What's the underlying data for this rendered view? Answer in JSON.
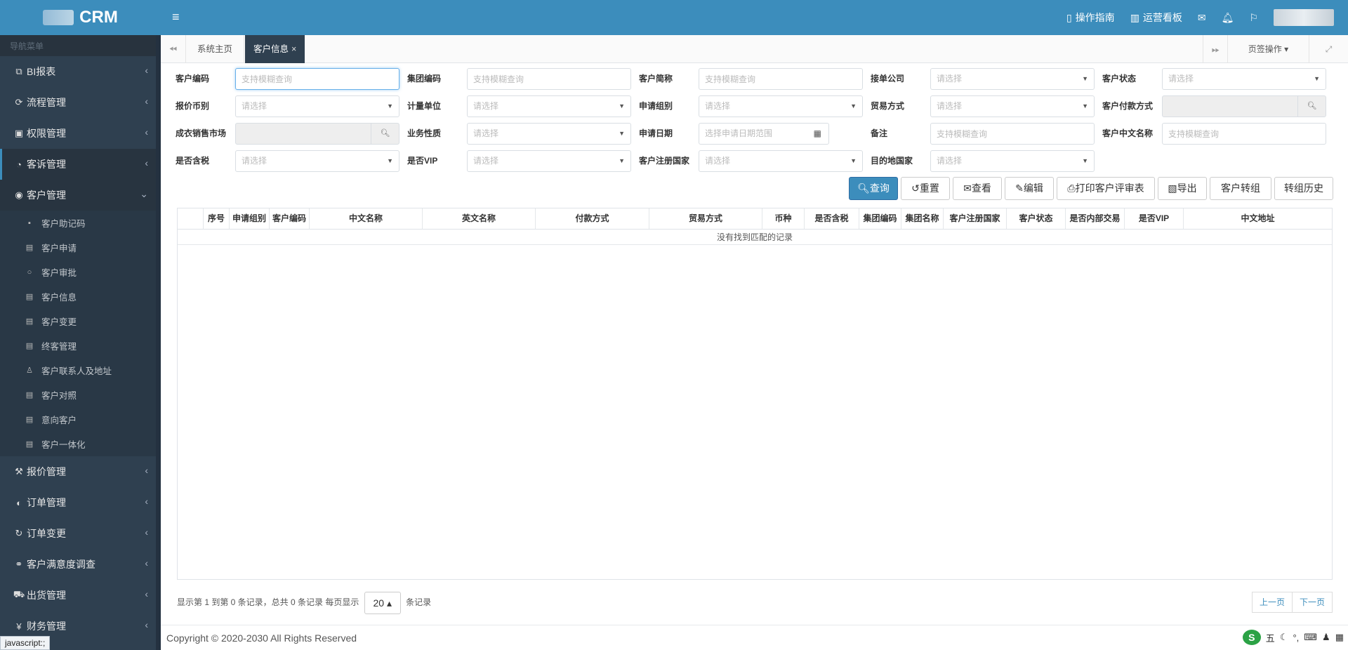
{
  "app": {
    "logo_text": "CRM"
  },
  "sidebar": {
    "nav_title": "导航菜单",
    "menu": [
      {
        "label": "BI报表",
        "icon": "clone-icon"
      },
      {
        "label": "流程管理",
        "icon": "flow-icon"
      },
      {
        "label": "权限管理",
        "icon": "lock-shield-icon"
      },
      {
        "label": "客诉管理",
        "icon": "complaint-icon"
      },
      {
        "label": "客户管理",
        "icon": "user-circle-icon"
      }
    ],
    "submenu": [
      {
        "label": "客户助记码",
        "icon": "id-card-icon"
      },
      {
        "label": "客户申请",
        "icon": "document-icon"
      },
      {
        "label": "客户审批",
        "icon": "circle-icon"
      },
      {
        "label": "客户信息",
        "icon": "document-icon"
      },
      {
        "label": "客户变更",
        "icon": "document-icon"
      },
      {
        "label": "终客管理",
        "icon": "document-icon"
      },
      {
        "label": "客户联系人及地址",
        "icon": "person-icon"
      },
      {
        "label": "客户对照",
        "icon": "document-icon"
      },
      {
        "label": "意向客户",
        "icon": "document-icon"
      },
      {
        "label": "客户一体化",
        "icon": "document-icon"
      }
    ],
    "menu_bottom": [
      {
        "label": "报价管理",
        "icon": "gavel-icon"
      },
      {
        "label": "订单管理",
        "icon": "compass-icon"
      },
      {
        "label": "订单变更",
        "icon": "refresh-icon"
      },
      {
        "label": "客户满意度调查",
        "icon": "handshake-icon"
      },
      {
        "label": "出货管理",
        "icon": "truck-icon"
      },
      {
        "label": "财务管理",
        "icon": "money-icon"
      }
    ]
  },
  "status_url": "javascript:;",
  "topbar": {
    "guide": "操作指南",
    "dashboard": "运营看板"
  },
  "tabs": {
    "home": "系统主页",
    "current": "客户信息",
    "close": "×",
    "ops": "页签操作"
  },
  "filters": {
    "cust_code": {
      "label": "客户编码",
      "placeholder": "支持模糊查询"
    },
    "group_code": {
      "label": "集团编码",
      "placeholder": "支持模糊查询"
    },
    "short_name": {
      "label": "客户简称",
      "placeholder": "支持模糊查询"
    },
    "company": {
      "label": "接单公司",
      "placeholder": "请选择"
    },
    "status": {
      "label": "客户状态",
      "placeholder": "请选择"
    },
    "currency": {
      "label": "报价币别",
      "placeholder": "请选择"
    },
    "unit": {
      "label": "计量单位",
      "placeholder": "请选择"
    },
    "apply_group": {
      "label": "申请组别",
      "placeholder": "请选择"
    },
    "trade": {
      "label": "贸易方式",
      "placeholder": "请选择"
    },
    "payment": {
      "label": "客户付款方式"
    },
    "market": {
      "label": "成衣销售市场"
    },
    "biz_type": {
      "label": "业务性质",
      "placeholder": "请选择"
    },
    "apply_date": {
      "label": "申请日期",
      "placeholder": "选择申请日期范围"
    },
    "remark": {
      "label": "备注",
      "placeholder": "支持模糊查询"
    },
    "cn_name": {
      "label": "客户中文名称",
      "placeholder": "支持模糊查询"
    },
    "tax": {
      "label": "是否含税",
      "placeholder": "请选择"
    },
    "vip": {
      "label": "是否VIP",
      "placeholder": "请选择"
    },
    "reg_country": {
      "label": "客户注册国家",
      "placeholder": "请选择"
    },
    "dest_country": {
      "label": "目的地国家",
      "placeholder": "请选择"
    }
  },
  "buttons": {
    "query": "查询",
    "reset": "重置",
    "view": "查看",
    "edit": "编辑",
    "print": "打印客户评审表",
    "export": "导出",
    "transfer": "客户转组",
    "history": "转组历史"
  },
  "table": {
    "columns": [
      "",
      "序号",
      "申请组别",
      "客户编码",
      "中文名称",
      "英文名称",
      "付款方式",
      "贸易方式",
      "币种",
      "是否含税",
      "集团编码",
      "集团名称",
      "客户注册国家",
      "客户状态",
      "是否内部交易",
      "是否VIP",
      "中文地址"
    ],
    "empty": "没有找到匹配的记录"
  },
  "pager": {
    "info": "显示第 1 到第 0 条记录，总共 0 条记录 每页显示",
    "page_size": "20",
    "suffix": "条记录",
    "prev": "上一页",
    "next": "下一页"
  },
  "footer": {
    "copyright": "Copyright © 2020-2030 All Rights Reserved"
  },
  "ime": {
    "logo": "S",
    "mode": "五"
  }
}
